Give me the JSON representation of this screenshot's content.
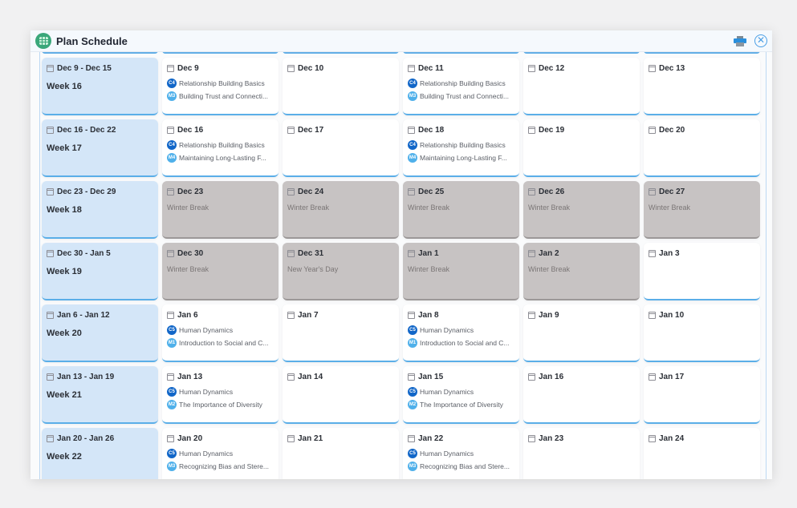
{
  "header": {
    "title": "Plan Schedule",
    "print_icon": "printer-icon",
    "close_icon": "close-circle-icon"
  },
  "colors": {
    "week_bg": "#d4e6f8",
    "holiday_bg": "#c7c3c3",
    "accent": "#5aaee8",
    "course_badge": "#1166c8",
    "module_badge": "#4fb0ea"
  },
  "weeks": [
    {
      "range": "Dec 9 - Dec 15",
      "label": "Week 16",
      "days": [
        {
          "date": "Dec 9",
          "items": [
            {
              "badge": "C4",
              "kind": "c",
              "text": "Relationship Building Basics"
            },
            {
              "badge": "M3",
              "kind": "m",
              "text": "Building Trust and Connecti..."
            }
          ]
        },
        {
          "date": "Dec 10",
          "items": []
        },
        {
          "date": "Dec 11",
          "items": [
            {
              "badge": "C4",
              "kind": "c",
              "text": "Relationship Building Basics"
            },
            {
              "badge": "M3",
              "kind": "m",
              "text": "Building Trust and Connecti..."
            }
          ]
        },
        {
          "date": "Dec 12",
          "items": []
        },
        {
          "date": "Dec 13",
          "items": []
        }
      ]
    },
    {
      "range": "Dec 16 - Dec 22",
      "label": "Week 17",
      "days": [
        {
          "date": "Dec 16",
          "items": [
            {
              "badge": "C4",
              "kind": "c",
              "text": "Relationship Building Basics"
            },
            {
              "badge": "M4",
              "kind": "m",
              "text": "Maintaining Long-Lasting F..."
            }
          ]
        },
        {
          "date": "Dec 17",
          "items": []
        },
        {
          "date": "Dec 18",
          "items": [
            {
              "badge": "C4",
              "kind": "c",
              "text": "Relationship Building Basics"
            },
            {
              "badge": "M4",
              "kind": "m",
              "text": "Maintaining Long-Lasting F..."
            }
          ]
        },
        {
          "date": "Dec 19",
          "items": []
        },
        {
          "date": "Dec 20",
          "items": []
        }
      ]
    },
    {
      "range": "Dec 23 - Dec 29",
      "label": "Week 18",
      "days": [
        {
          "date": "Dec 23",
          "holiday": "Winter Break"
        },
        {
          "date": "Dec 24",
          "holiday": "Winter Break"
        },
        {
          "date": "Dec 25",
          "holiday": "Winter Break"
        },
        {
          "date": "Dec 26",
          "holiday": "Winter Break"
        },
        {
          "date": "Dec 27",
          "holiday": "Winter Break"
        }
      ]
    },
    {
      "range": "Dec 30 - Jan 5",
      "label": "Week 19",
      "days": [
        {
          "date": "Dec 30",
          "holiday": "Winter Break"
        },
        {
          "date": "Dec 31",
          "holiday": "New Year's Day"
        },
        {
          "date": "Jan 1",
          "holiday": "Winter Break"
        },
        {
          "date": "Jan 2",
          "holiday": "Winter Break"
        },
        {
          "date": "Jan 3",
          "items": []
        }
      ]
    },
    {
      "range": "Jan 6 - Jan 12",
      "label": "Week 20",
      "days": [
        {
          "date": "Jan 6",
          "items": [
            {
              "badge": "C5",
              "kind": "c",
              "text": "Human Dynamics"
            },
            {
              "badge": "M1",
              "kind": "m",
              "text": "Introduction to Social and C..."
            }
          ]
        },
        {
          "date": "Jan 7",
          "items": []
        },
        {
          "date": "Jan 8",
          "items": [
            {
              "badge": "C5",
              "kind": "c",
              "text": "Human Dynamics"
            },
            {
              "badge": "M1",
              "kind": "m",
              "text": "Introduction to Social and C..."
            }
          ]
        },
        {
          "date": "Jan 9",
          "items": []
        },
        {
          "date": "Jan 10",
          "items": []
        }
      ]
    },
    {
      "range": "Jan 13 - Jan 19",
      "label": "Week 21",
      "days": [
        {
          "date": "Jan 13",
          "items": [
            {
              "badge": "C5",
              "kind": "c",
              "text": "Human Dynamics"
            },
            {
              "badge": "M2",
              "kind": "m",
              "text": "The Importance of Diversity"
            }
          ]
        },
        {
          "date": "Jan 14",
          "items": []
        },
        {
          "date": "Jan 15",
          "items": [
            {
              "badge": "C5",
              "kind": "c",
              "text": "Human Dynamics"
            },
            {
              "badge": "M2",
              "kind": "m",
              "text": "The Importance of Diversity"
            }
          ]
        },
        {
          "date": "Jan 16",
          "items": []
        },
        {
          "date": "Jan 17",
          "items": []
        }
      ]
    },
    {
      "range": "Jan 20 - Jan 26",
      "label": "Week 22",
      "days": [
        {
          "date": "Jan 20",
          "items": [
            {
              "badge": "C5",
              "kind": "c",
              "text": "Human Dynamics"
            },
            {
              "badge": "M3",
              "kind": "m",
              "text": "Recognizing Bias and Stere..."
            }
          ]
        },
        {
          "date": "Jan 21",
          "items": []
        },
        {
          "date": "Jan 22",
          "items": [
            {
              "badge": "C5",
              "kind": "c",
              "text": "Human Dynamics"
            },
            {
              "badge": "M3",
              "kind": "m",
              "text": "Recognizing Bias and Stere..."
            }
          ]
        },
        {
          "date": "Jan 23",
          "items": []
        },
        {
          "date": "Jan 24",
          "items": []
        }
      ]
    }
  ]
}
